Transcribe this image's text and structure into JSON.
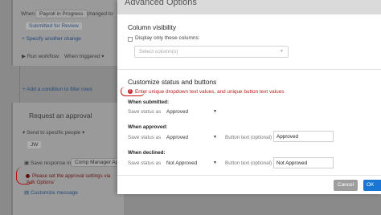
{
  "background": {
    "trigger": {
      "when_label": "When",
      "when_value": "Payroll in Progress",
      "changed_to": "changed to:",
      "status_chip": "Submitted for Review",
      "specify_link": "Specify another change"
    },
    "run_workflow": {
      "label": "Run workflow:",
      "value": "When triggered"
    },
    "add_condition": "Add a condition to filter rows",
    "approval": {
      "title": "Request an approval",
      "send_to": "Send to specific people",
      "recipient_chip": "JW",
      "save_response_label": "Save response in:",
      "save_response_value": "Comp Manager Approv",
      "error_text": "Please set the approval settings via 'Adv Options'",
      "customize_link": "Customize message"
    }
  },
  "modal": {
    "title": "Advanced Options",
    "column_visibility": {
      "heading": "Column visibility",
      "checkbox_label": "Display only these columns:",
      "select_placeholder": "Select column(s)"
    },
    "status_buttons": {
      "heading": "Customize status and buttons",
      "warning": "Enter unique dropdown text values, and unique button text values",
      "groups": [
        {
          "title": "When submitted:",
          "save_status_label": "Save status as",
          "status_value": "Approved"
        },
        {
          "title": "When approved:",
          "save_status_label": "Save status as",
          "status_value": "Approved",
          "button_text_label": "Button text (optional)",
          "button_text_value": "Approved"
        },
        {
          "title": "When declined:",
          "save_status_label": "Save status as",
          "status_value": "Not Approved",
          "button_text_label": "Button text (optional)",
          "button_text_value": "Not Approved"
        }
      ]
    },
    "footer": {
      "cancel_label": "Cancel",
      "ok_label": "OK"
    }
  },
  "colors": {
    "primary": "#1976d2",
    "error": "#c62828",
    "annotation_red": "#cc1111"
  },
  "icons": [
    "checkbox-icon",
    "chevron-down-icon",
    "error-icon",
    "plus-icon",
    "play-icon",
    "person-icon",
    "save-icon",
    "chat-icon"
  ]
}
